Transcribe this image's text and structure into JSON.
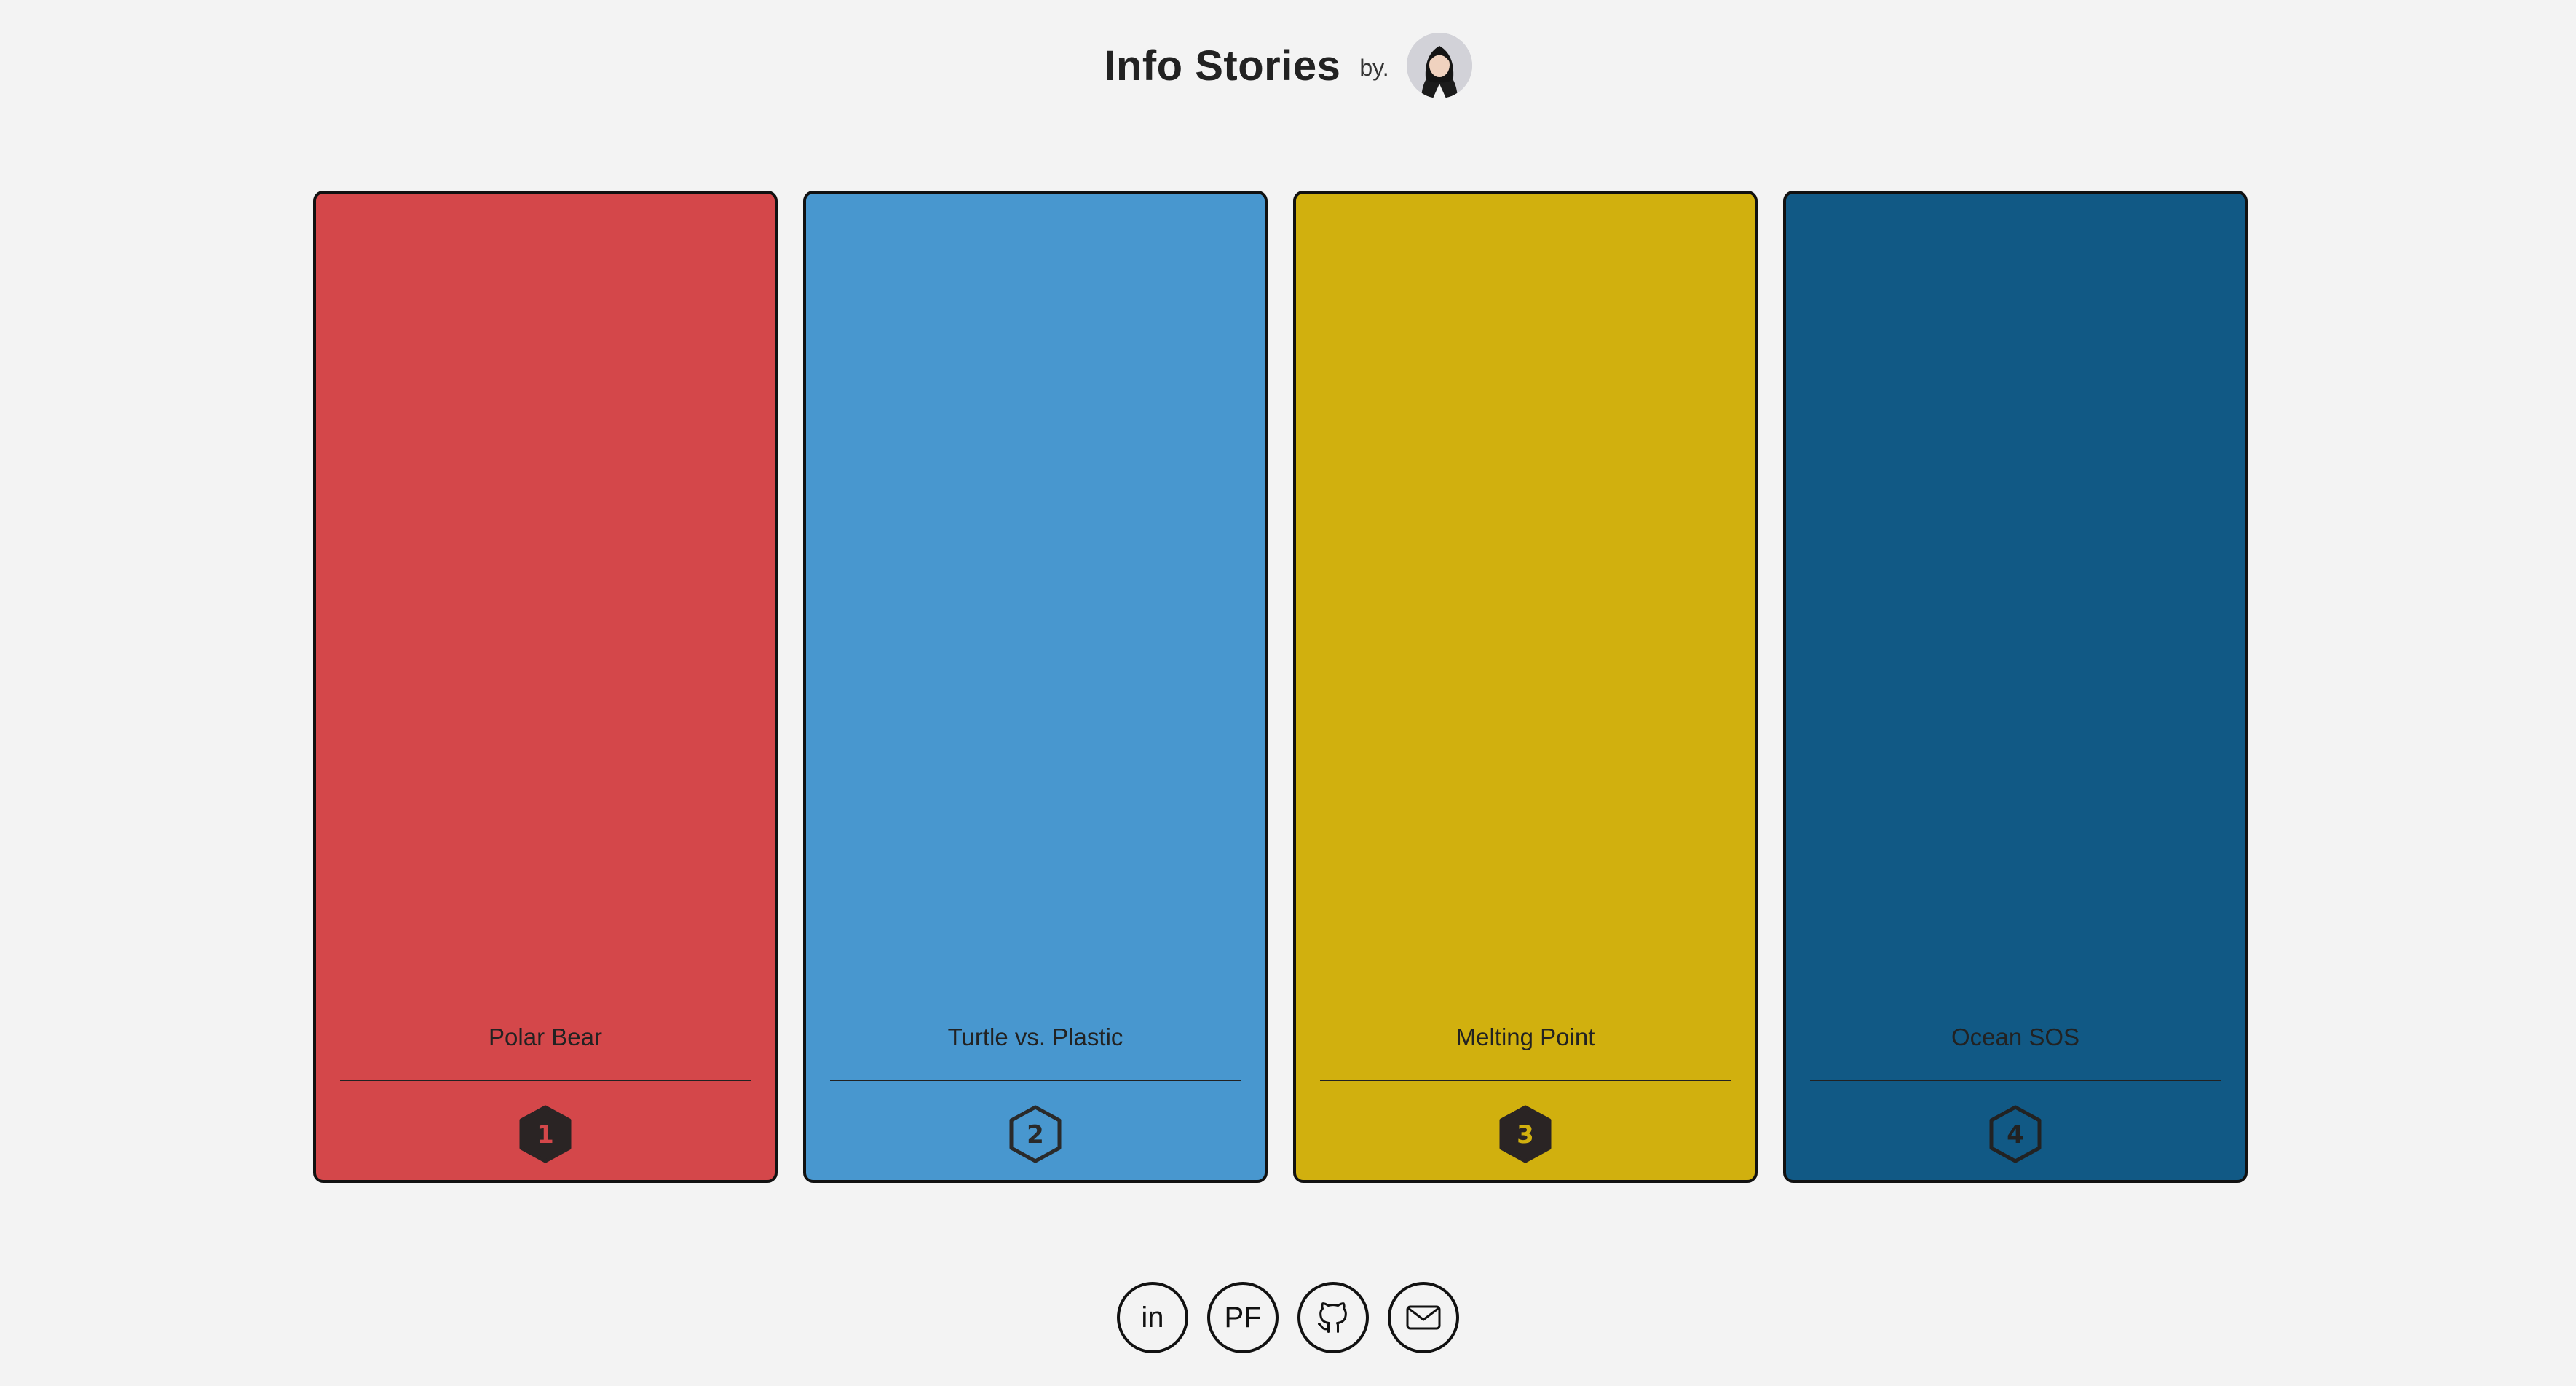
{
  "header": {
    "title": "Info Stories",
    "by_label": "by."
  },
  "cards": [
    {
      "title": "Polar Bear",
      "number": "1",
      "color": "#d4474a",
      "badge_style": "filled"
    },
    {
      "title": "Turtle vs. Plastic",
      "number": "2",
      "color": "#4897cf",
      "badge_style": "outline"
    },
    {
      "title": "Melting Point",
      "number": "3",
      "color": "#d1b00e",
      "badge_style": "filled"
    },
    {
      "title": "Ocean SOS",
      "number": "4",
      "color": "#115985",
      "badge_style": "outline"
    }
  ],
  "socials": [
    {
      "label": "in",
      "icon": "linkedin-icon"
    },
    {
      "label": "PF",
      "icon": "portfolio-icon"
    },
    {
      "label": "",
      "icon": "github-icon"
    },
    {
      "label": "",
      "icon": "mail-icon"
    }
  ]
}
